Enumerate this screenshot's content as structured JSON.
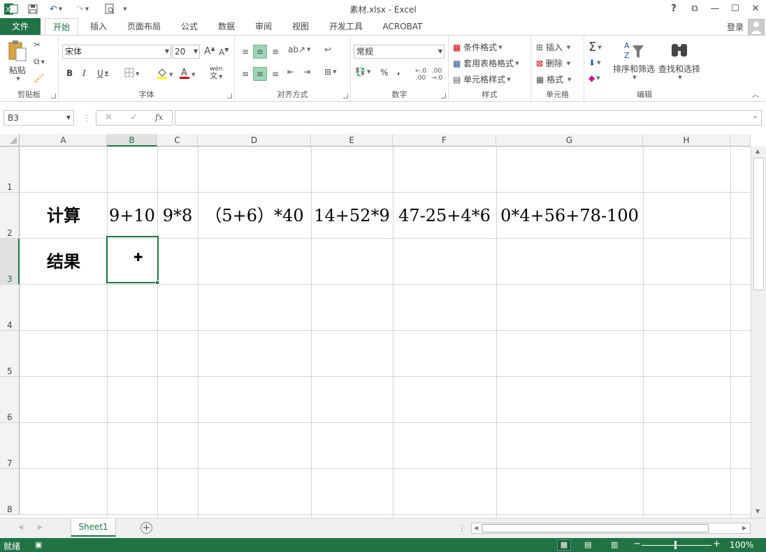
{
  "window": {
    "title": "素材.xlsx - Excel",
    "help": "?",
    "restore_ribbon": "⧉",
    "minimize": "—",
    "maximize": "☐",
    "close": "✕"
  },
  "tabs": {
    "file": "文件",
    "items": [
      "开始",
      "插入",
      "页面布局",
      "公式",
      "数据",
      "审阅",
      "视图",
      "开发工具",
      "ACROBAT"
    ],
    "login": "登录"
  },
  "ribbon": {
    "clipboard": {
      "label": "剪贴板",
      "paste": "粘贴"
    },
    "font": {
      "label": "字体",
      "name": "宋体",
      "size": "20",
      "bold": "B",
      "italic": "I",
      "underline": "U",
      "phonetic": "wén"
    },
    "alignment": {
      "label": "对齐方式"
    },
    "number": {
      "label": "数字",
      "format": "常规",
      "percent": "%",
      "comma": ","
    },
    "styles": {
      "label": "样式",
      "conditional": "条件格式",
      "table": "套用表格格式",
      "cell": "单元格样式"
    },
    "cells": {
      "label": "单元格",
      "insert": "插入",
      "delete": "删除",
      "format": "格式"
    },
    "editing": {
      "label": "编辑",
      "sort": "排序和筛选",
      "find": "查找和选择",
      "sum": "Σ"
    }
  },
  "formula_bar": {
    "name_box": "B3",
    "fx": "fx",
    "formula": ""
  },
  "grid": {
    "columns": [
      "A",
      "B",
      "C",
      "D",
      "E",
      "F",
      "G",
      "H"
    ],
    "active_column": "B",
    "rows": [
      "1",
      "2",
      "3",
      "4",
      "5",
      "6",
      "7",
      "8"
    ],
    "active_row": "3",
    "row2": {
      "a": "计算",
      "b": "9+10",
      "c": "9*8",
      "d": "（5+6）*40",
      "e": "14+52*9",
      "f": "47-25+4*6",
      "g": "0*4+56+78-100"
    },
    "row3": {
      "a": "结果"
    }
  },
  "sheets": {
    "active": "Sheet1",
    "add": "+"
  },
  "status": {
    "ready": "就绪",
    "zoom": "100%"
  },
  "colors": {
    "accent": "#217346",
    "selection": "#217346"
  }
}
